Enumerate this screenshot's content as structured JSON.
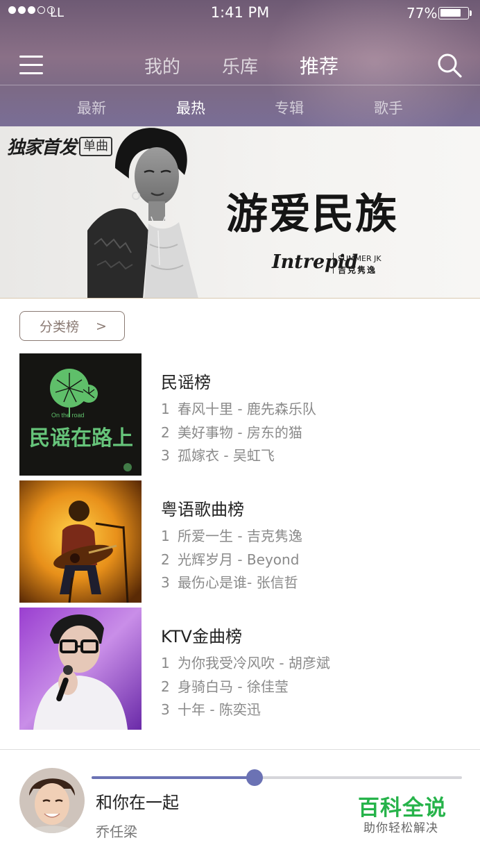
{
  "status_bar": {
    "carrier": "LL",
    "time": "1:41 PM",
    "battery_percent": "77%",
    "battery_level": 0.77,
    "signal_bars_filled": 3,
    "signal_bars_total": 5
  },
  "header": {
    "menu_icon": "menu-icon",
    "tabs": [
      {
        "label": "我的",
        "active": false
      },
      {
        "label": "乐库",
        "active": false
      },
      {
        "label": "推荐",
        "active": true
      }
    ],
    "search_icon": "search-icon",
    "sub_tabs": [
      {
        "label": "最新",
        "active": false
      },
      {
        "label": "最热",
        "active": true
      },
      {
        "label": "专辑",
        "active": false
      },
      {
        "label": "歌手",
        "active": false
      }
    ]
  },
  "banner": {
    "badge": "独家首发",
    "badge_tag": "单曲",
    "album_title": "游爱民族",
    "brand_logo": "Intrepid",
    "brand_en": "SUMMER JK",
    "brand_cn": "吉克隽逸"
  },
  "category_button": {
    "label": "分类榜",
    "arrow": ">"
  },
  "charts": [
    {
      "title": "民谣榜",
      "cover_text": "民谣在路上",
      "cover_subtext": "On the road",
      "tracks": [
        {
          "num": "1",
          "text": "春风十里 - 鹿先森乐队"
        },
        {
          "num": "2",
          "text": "美好事物 - 房东的猫"
        },
        {
          "num": "3",
          "text": "孤嫁衣 - 吴虹飞"
        }
      ]
    },
    {
      "title": "粤语歌曲榜",
      "tracks": [
        {
          "num": "1",
          "text": "所爱一生 - 吉克隽逸"
        },
        {
          "num": "2",
          "text": "光辉岁月 - Beyond"
        },
        {
          "num": "3",
          "text": "最伤心是谁- 张信哲"
        }
      ]
    },
    {
      "title": "KTV金曲榜",
      "tracks": [
        {
          "num": "1",
          "text": "为你我受冷风吹 - 胡彦斌"
        },
        {
          "num": "2",
          "text": "身骑白马 - 徐佳莹"
        },
        {
          "num": "3",
          "text": "十年 - 陈奕迅"
        }
      ]
    }
  ],
  "player": {
    "song_title": "和你在一起",
    "artist": "乔任梁",
    "progress": 0.44,
    "accent_color": "#6b72b4"
  },
  "watermark": {
    "main": "百科全说",
    "sub": "助你轻松解决"
  }
}
